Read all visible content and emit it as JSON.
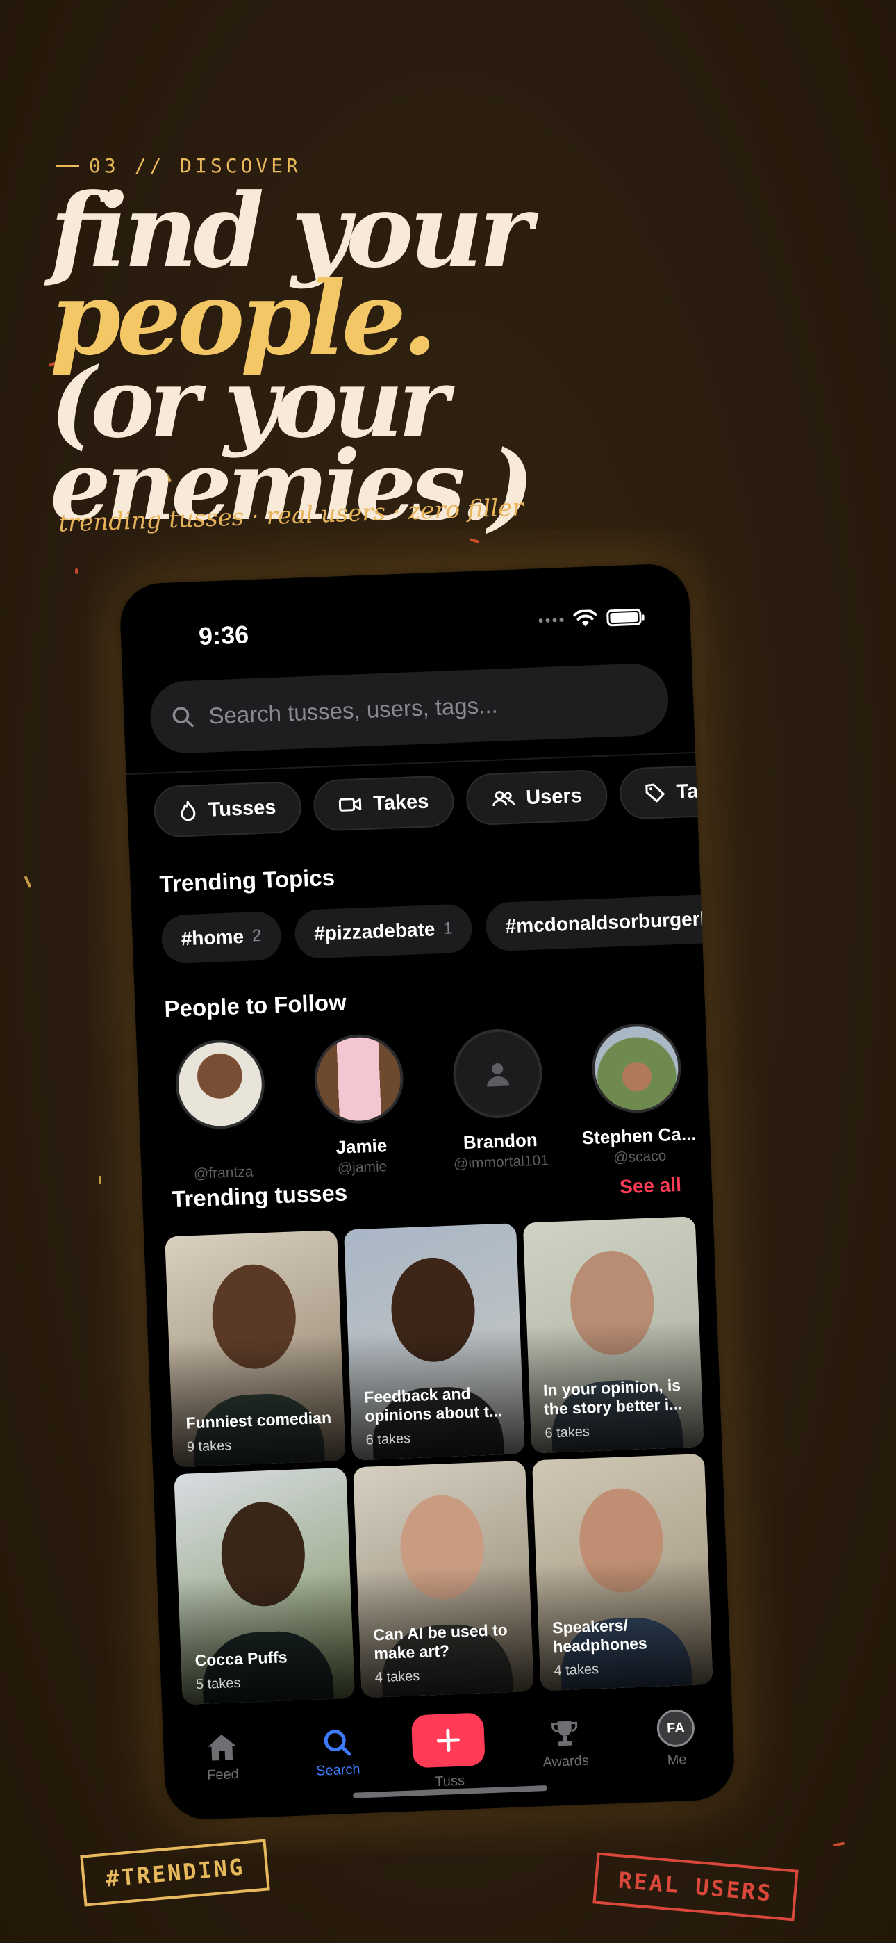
{
  "kicker": "03 // DISCOVER",
  "headline": {
    "line1": "find your",
    "line2": "people.",
    "line3": "(or your enemies.)"
  },
  "tagline": "trending tusses · real users · zero filler",
  "status": {
    "time": "9:36"
  },
  "search": {
    "placeholder": "Search tusses, users, tags..."
  },
  "filters": [
    {
      "label": "Tusses",
      "icon": "flame-icon"
    },
    {
      "label": "Takes",
      "icon": "video-icon"
    },
    {
      "label": "Users",
      "icon": "users-icon"
    },
    {
      "label": "Tags",
      "icon": "tag-icon"
    }
  ],
  "trending_topics": {
    "title": "Trending Topics",
    "items": [
      {
        "tag": "#home",
        "count": "2"
      },
      {
        "tag": "#pizzadebate",
        "count": "1"
      },
      {
        "tag": "#mcdonaldsorburgerki",
        "count": ""
      }
    ]
  },
  "people": {
    "title": "People to Follow",
    "items": [
      {
        "name": "",
        "handle": "@frantza"
      },
      {
        "name": "Jamie",
        "handle": "@jamie"
      },
      {
        "name": "Brandon",
        "handle": "@immortal101"
      },
      {
        "name": "Stephen Ca...",
        "handle": "@scaco"
      }
    ]
  },
  "trending_tusses": {
    "title": "Trending tusses",
    "see_all": "See all",
    "items": [
      {
        "title": "Funniest comedian",
        "takes": "9 takes"
      },
      {
        "title": "Feedback and opinions about t...",
        "takes": "6 takes"
      },
      {
        "title": "In your opinion, is the story better i...",
        "takes": "6 takes"
      },
      {
        "title": "Cocca Puffs",
        "takes": "5 takes"
      },
      {
        "title": "Can AI be used to make art?",
        "takes": "4 takes"
      },
      {
        "title": "Speakers/ headphones",
        "takes": "4 takes"
      }
    ]
  },
  "tabbar": {
    "feed": "Feed",
    "search": "Search",
    "tuss": "Tuss",
    "awards": "Awards",
    "me": "Me",
    "me_initials": "FA"
  },
  "stamps": {
    "left": "#TRENDING",
    "right": "REAL USERS"
  },
  "colors": {
    "accent_red": "#ff3b56",
    "accent_gold": "#f3c766",
    "tab_active": "#3d7bff"
  }
}
